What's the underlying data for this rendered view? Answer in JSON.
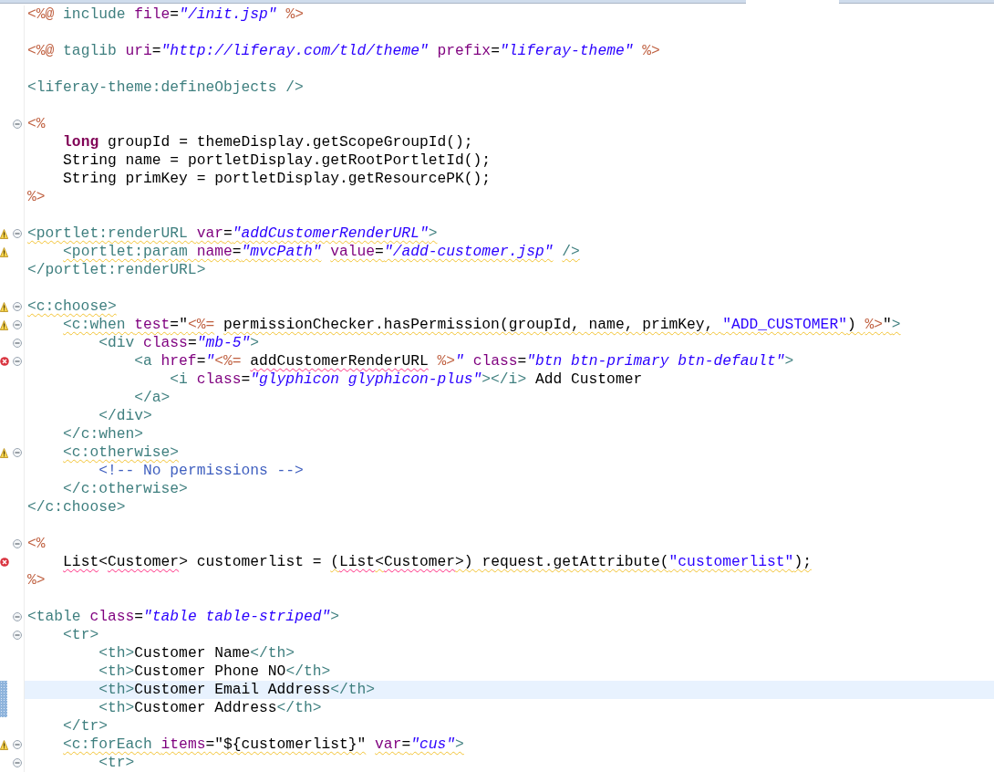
{
  "editor": {
    "lines": [
      {
        "kind": "code",
        "fold": false,
        "tokens": [
          {
            "text": "<%@",
            "kind": "delim"
          },
          {
            "text": " include ",
            "kind": "tag"
          },
          {
            "text": "file",
            "kind": "attr"
          },
          {
            "text": "=",
            "kind": "plain"
          },
          {
            "text": "\"/init.jsp\"",
            "kind": "value"
          },
          {
            "text": " %>",
            "kind": "delim"
          }
        ]
      },
      {
        "kind": "blank",
        "fold": false
      },
      {
        "kind": "code",
        "fold": false,
        "tokens": [
          {
            "text": "<%@",
            "kind": "delim"
          },
          {
            "text": " taglib ",
            "kind": "tag"
          },
          {
            "text": "uri",
            "kind": "attr"
          },
          {
            "text": "=",
            "kind": "plain"
          },
          {
            "text": "\"http://liferay.com/tld/theme\"",
            "kind": "value"
          },
          {
            "text": " prefix",
            "kind": "attr"
          },
          {
            "text": "=",
            "kind": "plain"
          },
          {
            "text": "\"liferay-theme\"",
            "kind": "value"
          },
          {
            "text": " %>",
            "kind": "delim"
          }
        ]
      },
      {
        "kind": "blank",
        "fold": false
      },
      {
        "kind": "code",
        "fold": false,
        "tokens": [
          {
            "text": "<liferay-theme:defineObjects />",
            "kind": "tag"
          }
        ]
      },
      {
        "kind": "blank",
        "fold": false
      },
      {
        "kind": "code",
        "fold": true,
        "tokens": [
          {
            "text": "<%",
            "kind": "delim"
          }
        ]
      },
      {
        "kind": "code",
        "fold": false,
        "tokens": [
          {
            "text": "    long",
            "kind": "keyword"
          },
          {
            "text": " groupId = themeDisplay.getScopeGroupId();",
            "kind": "plain"
          }
        ]
      },
      {
        "kind": "code",
        "fold": false,
        "tokens": [
          {
            "text": "    String name = portletDisplay.getRootPortletId();",
            "kind": "plain"
          }
        ]
      },
      {
        "kind": "code",
        "fold": false,
        "tokens": [
          {
            "text": "    String primKey = portletDisplay.getResourcePK();",
            "kind": "plain"
          }
        ]
      },
      {
        "kind": "code",
        "fold": false,
        "tokens": [
          {
            "text": "%>",
            "kind": "delim"
          }
        ]
      },
      {
        "kind": "blank",
        "fold": false
      },
      {
        "kind": "code",
        "fold": true,
        "warning": true,
        "tokens": [
          {
            "text": "<portlet:renderURL ",
            "kind": "tag",
            "warning_underline": true
          },
          {
            "text": "var",
            "kind": "attr",
            "warning_underline": true
          },
          {
            "text": "=",
            "kind": "plain",
            "warning_underline": true
          },
          {
            "text": "\"addCustomerRenderURL\"",
            "kind": "value",
            "warning_underline": true
          },
          {
            "text": ">",
            "kind": "tag",
            "warning_underline": true
          }
        ]
      },
      {
        "kind": "code",
        "fold": false,
        "warning": true,
        "tokens": [
          {
            "text": "    <portlet:param ",
            "kind": "tag",
            "warning_underline": true
          },
          {
            "text": "name",
            "kind": "attr",
            "warning_underline": true
          },
          {
            "text": "=",
            "kind": "plain",
            "warning_underline": true
          },
          {
            "text": "\"mvcPath\"",
            "kind": "value",
            "warning_underline": true
          },
          {
            "text": " value",
            "kind": "attr",
            "warning_underline": true
          },
          {
            "text": "=",
            "kind": "plain",
            "warning_underline": true
          },
          {
            "text": "\"/add-customer.jsp\"",
            "kind": "value",
            "warning_underline": true
          },
          {
            "text": " />",
            "kind": "tag",
            "warning_underline": true
          }
        ]
      },
      {
        "kind": "code",
        "fold": false,
        "tokens": [
          {
            "text": "</portlet:renderURL>",
            "kind": "tag"
          }
        ]
      },
      {
        "kind": "blank",
        "fold": false
      },
      {
        "kind": "code",
        "fold": true,
        "warning": true,
        "tokens": [
          {
            "text": "<c:choose>",
            "kind": "tag",
            "warning_underline": true
          }
        ]
      },
      {
        "kind": "code",
        "fold": true,
        "warning": true,
        "tokens": [
          {
            "text": "    <c:when ",
            "kind": "tag",
            "warning_underline": true
          },
          {
            "text": "test",
            "kind": "attr",
            "warning_underline": true
          },
          {
            "text": "=\"",
            "kind": "plain",
            "warning_underline": true
          },
          {
            "text": "<%=",
            "kind": "delim",
            "warning_underline": true
          },
          {
            "text": " permissionChecker.hasPermission(groupId, name, primKey, ",
            "kind": "plain",
            "warning_underline": true
          },
          {
            "text": "\"ADD_CUSTOMER\"",
            "kind": "string",
            "warning_underline": true
          },
          {
            "text": ") ",
            "kind": "plain",
            "warning_underline": true
          },
          {
            "text": "%>",
            "kind": "delim",
            "warning_underline": true
          },
          {
            "text": "\"",
            "kind": "plain",
            "warning_underline": true
          },
          {
            "text": ">",
            "kind": "tag",
            "warning_underline": true
          }
        ]
      },
      {
        "kind": "code",
        "fold": true,
        "tokens": [
          {
            "text": "        <div ",
            "kind": "tag"
          },
          {
            "text": "class",
            "kind": "attr"
          },
          {
            "text": "=",
            "kind": "plain"
          },
          {
            "text": "\"mb-5\"",
            "kind": "value"
          },
          {
            "text": ">",
            "kind": "tag"
          }
        ]
      },
      {
        "kind": "code",
        "fold": true,
        "error": true,
        "tokens": [
          {
            "text": "            <a ",
            "kind": "tag"
          },
          {
            "text": "href",
            "kind": "attr"
          },
          {
            "text": "=",
            "kind": "plain"
          },
          {
            "text": "\"",
            "kind": "value"
          },
          {
            "text": "<%= ",
            "kind": "delim"
          },
          {
            "text": "addCustomerRenderURL",
            "kind": "plain",
            "error_underline": true
          },
          {
            "text": " %>",
            "kind": "delim"
          },
          {
            "text": "\"",
            "kind": "value"
          },
          {
            "text": " class",
            "kind": "attr"
          },
          {
            "text": "=",
            "kind": "plain"
          },
          {
            "text": "\"btn btn-primary btn-default\"",
            "kind": "value"
          },
          {
            "text": ">",
            "kind": "tag"
          }
        ]
      },
      {
        "kind": "code",
        "fold": false,
        "tokens": [
          {
            "text": "                <i ",
            "kind": "tag"
          },
          {
            "text": "class",
            "kind": "attr"
          },
          {
            "text": "=",
            "kind": "plain"
          },
          {
            "text": "\"glyphicon glyphicon-plus\"",
            "kind": "value"
          },
          {
            "text": "></i>",
            "kind": "tag"
          },
          {
            "text": " Add Customer",
            "kind": "plain"
          }
        ]
      },
      {
        "kind": "code",
        "fold": false,
        "tokens": [
          {
            "text": "            </a>",
            "kind": "tag"
          }
        ]
      },
      {
        "kind": "code",
        "fold": false,
        "tokens": [
          {
            "text": "        </div>",
            "kind": "tag"
          }
        ]
      },
      {
        "kind": "code",
        "fold": false,
        "tokens": [
          {
            "text": "    </c:when>",
            "kind": "tag"
          }
        ]
      },
      {
        "kind": "code",
        "fold": true,
        "warning": true,
        "tokens": [
          {
            "text": "    <c:otherwise>",
            "kind": "tag",
            "warning_underline": true
          }
        ]
      },
      {
        "kind": "code",
        "fold": false,
        "tokens": [
          {
            "text": "        <!-- No permissions -->",
            "kind": "comment"
          }
        ]
      },
      {
        "kind": "code",
        "fold": false,
        "tokens": [
          {
            "text": "    </c:otherwise>",
            "kind": "tag"
          }
        ]
      },
      {
        "kind": "code",
        "fold": false,
        "tokens": [
          {
            "text": "</c:choose>",
            "kind": "tag"
          }
        ]
      },
      {
        "kind": "blank",
        "fold": false
      },
      {
        "kind": "code",
        "fold": true,
        "tokens": [
          {
            "text": "<%",
            "kind": "delim"
          }
        ]
      },
      {
        "kind": "code",
        "fold": false,
        "error": true,
        "tokens": [
          {
            "text": "    List",
            "kind": "plain",
            "error_underline": true
          },
          {
            "text": "<",
            "kind": "plain"
          },
          {
            "text": "Customer",
            "kind": "plain",
            "error_underline": true
          },
          {
            "text": "> customerlist = ",
            "kind": "plain"
          },
          {
            "text": "(",
            "kind": "plain",
            "warning_underline": true
          },
          {
            "text": "List",
            "kind": "plain",
            "error_underline": true
          },
          {
            "text": "<",
            "kind": "plain",
            "warning_underline": true
          },
          {
            "text": "Customer",
            "kind": "plain",
            "error_underline": true
          },
          {
            "text": ">) request.getAttribute(",
            "kind": "plain",
            "warning_underline": true
          },
          {
            "text": "\"customerlist\"",
            "kind": "string",
            "warning_underline": true
          },
          {
            "text": ");",
            "kind": "plain",
            "warning_underline": true
          }
        ]
      },
      {
        "kind": "code",
        "fold": false,
        "tokens": [
          {
            "text": "%>",
            "kind": "delim"
          }
        ]
      },
      {
        "kind": "blank",
        "fold": false
      },
      {
        "kind": "code",
        "fold": true,
        "tokens": [
          {
            "text": "<table ",
            "kind": "tag"
          },
          {
            "text": "class",
            "kind": "attr"
          },
          {
            "text": "=",
            "kind": "plain"
          },
          {
            "text": "\"table table-striped\"",
            "kind": "value"
          },
          {
            "text": ">",
            "kind": "tag"
          }
        ]
      },
      {
        "kind": "code",
        "fold": true,
        "tokens": [
          {
            "text": "    <tr>",
            "kind": "tag"
          }
        ]
      },
      {
        "kind": "code",
        "fold": false,
        "tokens": [
          {
            "text": "        <th>",
            "kind": "tag"
          },
          {
            "text": "Customer Name",
            "kind": "plain"
          },
          {
            "text": "</th>",
            "kind": "tag"
          }
        ]
      },
      {
        "kind": "code",
        "fold": false,
        "tokens": [
          {
            "text": "        <th>",
            "kind": "tag"
          },
          {
            "text": "Customer Phone NO",
            "kind": "plain"
          },
          {
            "text": "</th>",
            "kind": "tag"
          }
        ]
      },
      {
        "kind": "code",
        "fold": false,
        "current": true,
        "changed": true,
        "tokens": [
          {
            "text": "        <th>",
            "kind": "tag"
          },
          {
            "text": "Customer Email Address",
            "kind": "plain"
          },
          {
            "text": "</th>",
            "kind": "tag"
          }
        ]
      },
      {
        "kind": "code",
        "fold": false,
        "changed": true,
        "tokens": [
          {
            "text": "        <th>",
            "kind": "tag"
          },
          {
            "text": "Customer Address",
            "kind": "plain"
          },
          {
            "text": "</th>",
            "kind": "tag"
          }
        ]
      },
      {
        "kind": "code",
        "fold": false,
        "tokens": [
          {
            "text": "    </tr>",
            "kind": "tag"
          }
        ]
      },
      {
        "kind": "code",
        "fold": true,
        "warning": true,
        "tokens": [
          {
            "text": "    <c:forEach ",
            "kind": "tag",
            "warning_underline": true
          },
          {
            "text": "items",
            "kind": "attr",
            "warning_underline": true
          },
          {
            "text": "=\"${customerlist}\"",
            "kind": "plain",
            "warning_underline": true
          },
          {
            "text": " var",
            "kind": "attr",
            "warning_underline": true
          },
          {
            "text": "=",
            "kind": "plain",
            "warning_underline": true
          },
          {
            "text": "\"cus\"",
            "kind": "value",
            "warning_underline": true
          },
          {
            "text": ">",
            "kind": "tag",
            "warning_underline": true
          }
        ]
      },
      {
        "kind": "code",
        "fold": true,
        "tokens": [
          {
            "text": "        <tr>",
            "kind": "tag"
          }
        ]
      }
    ]
  }
}
